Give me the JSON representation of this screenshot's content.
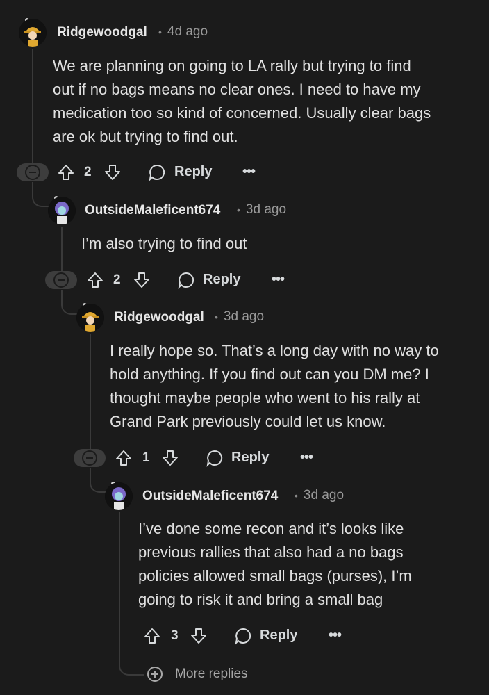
{
  "comments": [
    {
      "username": "Ridgewoodgal",
      "sep": "•",
      "age": "4d ago",
      "lines": [
        "We are planning on going to LA rally but trying to find",
        "out if no bags means no clear ones. I need to have my",
        "medication too so kind of concerned. Usually clear bags",
        "are ok but trying to find out."
      ],
      "votes": "2",
      "reply_label": "Reply",
      "more": "•••"
    },
    {
      "username": "OutsideMaleficent674",
      "sep": "•",
      "age": "3d ago",
      "lines": [
        "I’m also trying to find out"
      ],
      "votes": "2",
      "reply_label": "Reply",
      "more": "•••"
    },
    {
      "username": "Ridgewoodgal",
      "sep": "•",
      "age": "3d ago",
      "lines": [
        "I really hope so. That’s a long day with no way to",
        "hold anything. If you find out can you DM me? I",
        "thought maybe people who went to his rally at",
        "Grand Park previously could let us know."
      ],
      "votes": "1",
      "reply_label": "Reply",
      "more": "•••"
    },
    {
      "username": "OutsideMaleficent674",
      "sep": "•",
      "age": "3d ago",
      "lines": [
        "I’ve done some recon and it’s looks like",
        "previous rallies that also had a no bags",
        "policies allowed small bags (purses), I’m",
        "going to risk it and bring a small bag"
      ],
      "votes": "3",
      "reply_label": "Reply",
      "more": "•••"
    }
  ],
  "more_replies": {
    "label": "More replies"
  },
  "icons": {
    "upvote": "upvote-icon",
    "downvote": "downvote-icon",
    "reply": "reply-bubble-icon",
    "collapse": "collapse-minus-icon",
    "expand": "plus-circle-icon"
  },
  "colors": {
    "background": "#1b1b1b",
    "text": "#e0e0e0",
    "muted": "#9a9a9a",
    "thread_line": "#3a3a3a"
  }
}
